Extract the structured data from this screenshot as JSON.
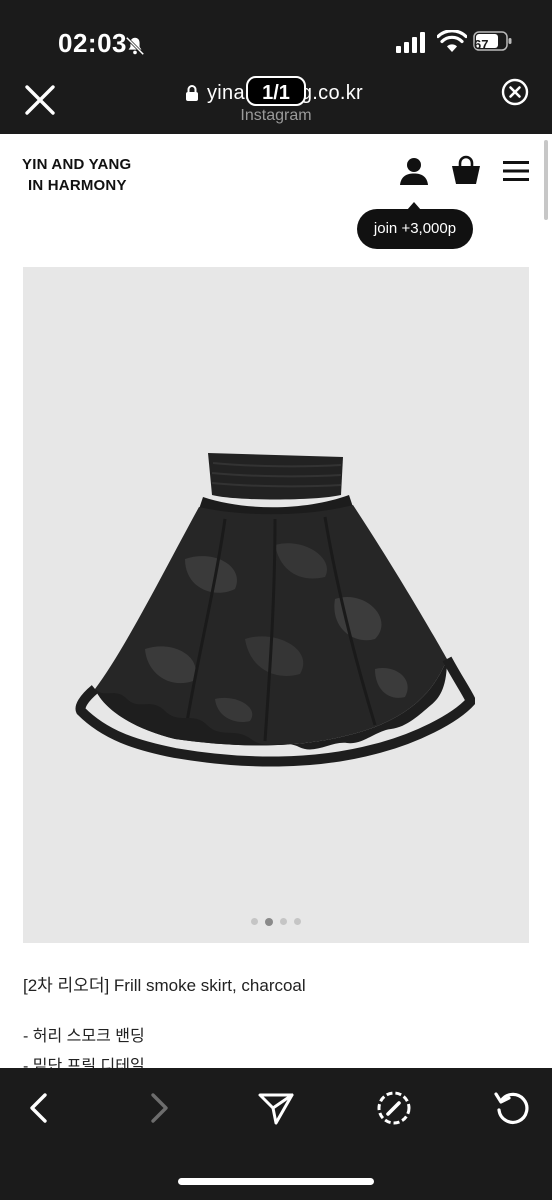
{
  "status_bar": {
    "time": "02:03",
    "battery": "67"
  },
  "browser": {
    "url": "yinandyang.co.kr",
    "page_counter": "1/1",
    "source": "Instagram"
  },
  "site": {
    "brand_line1": "YIN AND YANG",
    "brand_line2": "IN HARMONY",
    "join_tooltip": "join +3,000p"
  },
  "carousel": {
    "total": 4,
    "active_index": 1
  },
  "product": {
    "title": "[2차 리오더] Frill smoke skirt, charcoal",
    "details": [
      "- 허리 스모크 밴딩",
      "- 밑단 프릴 디테일"
    ]
  },
  "icons": {
    "close": "close-icon",
    "lock": "lock-icon",
    "cancel": "cancel-circle-icon",
    "user": "user-icon",
    "bag": "shopping-bag-icon",
    "menu": "hamburger-menu-icon",
    "back": "chevron-left-icon",
    "forward": "chevron-right-icon",
    "share": "send-icon",
    "compass": "compass-icon",
    "reload": "reload-icon"
  },
  "colors": {
    "chrome_bg": "#1b1b1b",
    "page_bg": "#ffffff",
    "image_bg": "#e7e7e7",
    "tooltip_bg": "#111111"
  }
}
